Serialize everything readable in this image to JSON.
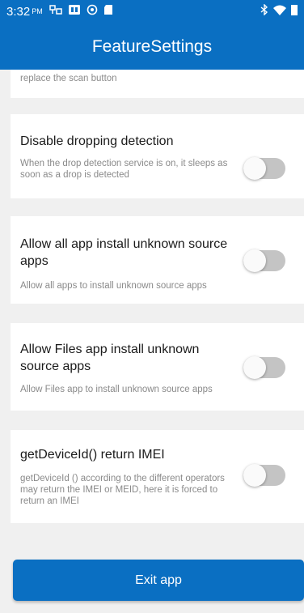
{
  "status_bar": {
    "time": "3:32",
    "ampm": "PM"
  },
  "app_bar": {
    "title": "FeatureSettings"
  },
  "settings": [
    {
      "title": "",
      "description": "replace the scan button"
    },
    {
      "title": "Disable dropping detection",
      "description": "When the drop detection service is on, it sleeps as soon as a drop is detected",
      "enabled": false
    },
    {
      "title": "Allow all app install unknown source apps",
      "description": "Allow all apps to install unknown source apps",
      "enabled": false
    },
    {
      "title": "Allow Files app install unknown source apps",
      "description": "Allow Files app to install unknown source apps",
      "enabled": false
    },
    {
      "title": "getDeviceId() return IMEI",
      "description": "getDeviceId () according to the different operators may return the IMEI or MEID, here it is forced to return an IMEI",
      "enabled": false
    }
  ],
  "exit_button": {
    "label": "Exit app"
  },
  "colors": {
    "primary": "#0a6fc2",
    "switch_off_track": "#c4c4c4",
    "background": "#f0f0f0"
  }
}
